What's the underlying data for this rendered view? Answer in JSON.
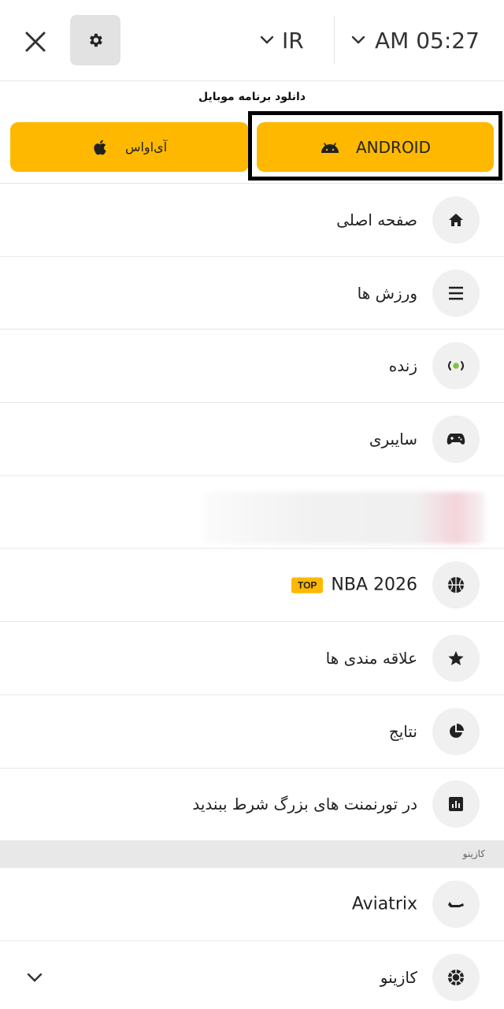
{
  "header": {
    "language": "IR",
    "time": "AM 05:27"
  },
  "download": {
    "title": "دانلود برنامه موبایل",
    "ios_label": "آی‌اواس",
    "android_label": "ANDROID"
  },
  "menu": {
    "items": [
      {
        "label": "صفحه اصلی",
        "icon": "home-icon"
      },
      {
        "label": "ورزش ها",
        "icon": "list-icon"
      },
      {
        "label": "زنده",
        "icon": "live-icon"
      },
      {
        "label": "سایبری",
        "icon": "gamepad-icon"
      },
      {
        "label": "",
        "icon": "blurred"
      },
      {
        "label": "NBA 2026",
        "badge": "TOP",
        "icon": "basketball-icon"
      },
      {
        "label": "علاقه مندی ها",
        "icon": "star-icon"
      },
      {
        "label": "نتایج",
        "icon": "pie-chart-icon"
      },
      {
        "label": "در تورنمنت های بزرگ شرط ببندید",
        "icon": "bar-chart-icon"
      }
    ]
  },
  "casino_section": {
    "title": "کازینو",
    "items": [
      {
        "label": "Aviatrix",
        "icon": "plane-icon"
      },
      {
        "label": "کازینو",
        "icon": "casino-chip-icon"
      }
    ]
  },
  "colors": {
    "accent": "#ffb800",
    "live_dot": "#7dc242"
  }
}
